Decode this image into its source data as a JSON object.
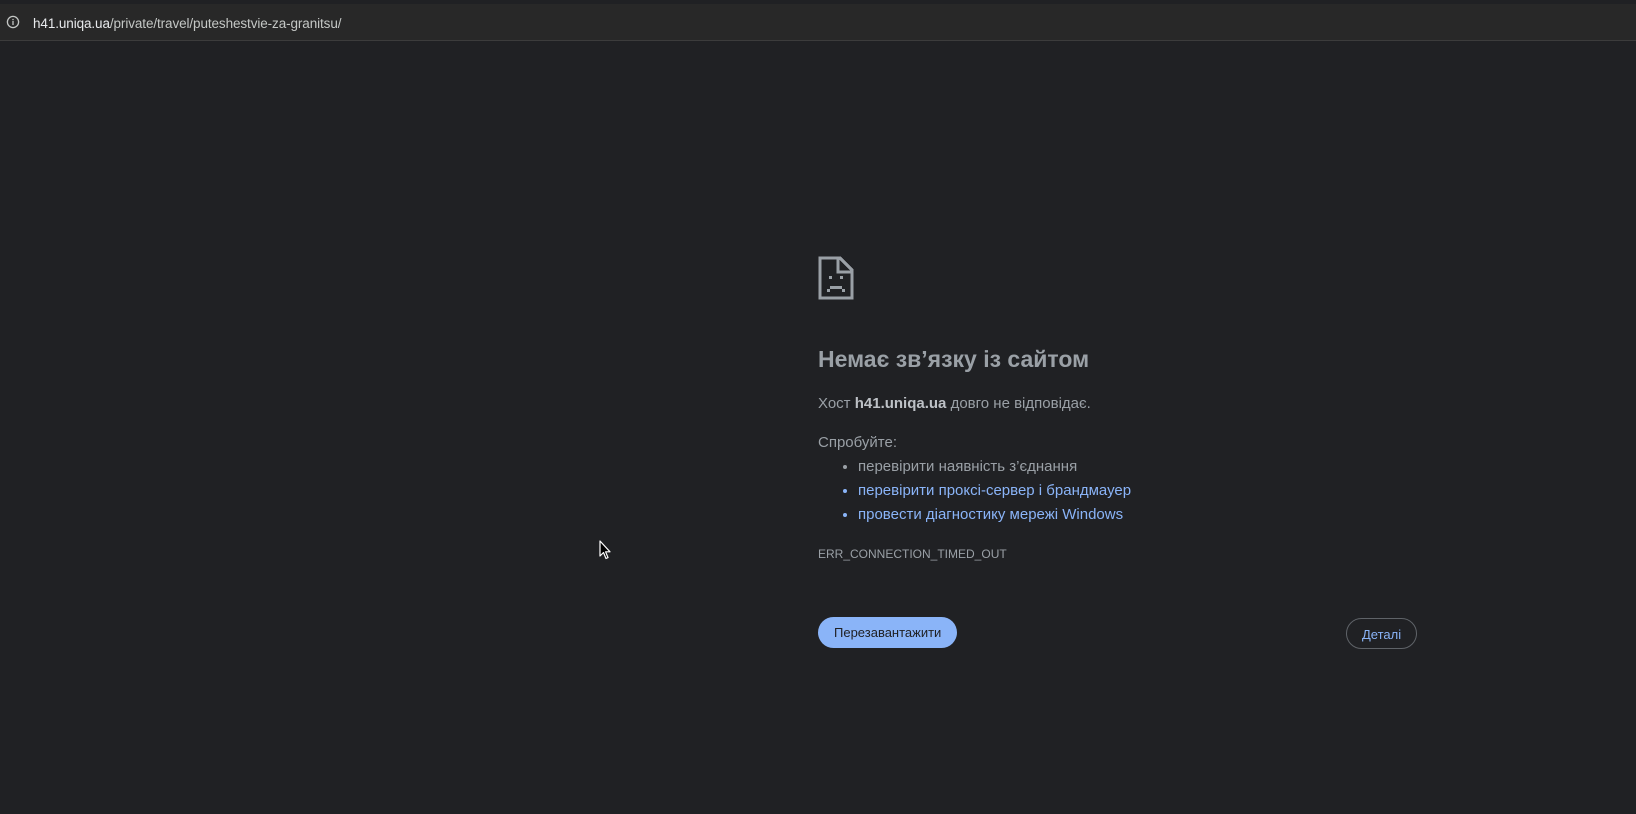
{
  "address_bar": {
    "url_host": "h41.uniqa.ua",
    "url_path": "/private/travel/puteshestvie-za-granitsu/",
    "info_icon": "info-icon"
  },
  "error": {
    "icon": "sad-page-icon",
    "title": "Немає зв’язку із сайтом",
    "desc_prefix": "Хост ",
    "desc_host": "h41.uniqa.ua",
    "desc_suffix": " довго не відповідає.",
    "try_label": "Спробуйте:",
    "suggestions": [
      "перевірити наявність з’єднання",
      "перевірити проксі-сервер і брандмауер",
      "провести діагностику мережі Windows"
    ],
    "code": "ERR_CONNECTION_TIMED_OUT"
  },
  "buttons": {
    "reload": "Перезавантажити",
    "details": "Деталі"
  },
  "colors": {
    "background": "#202124",
    "accent": "#8ab4f8",
    "text": "#9aa0a6"
  }
}
